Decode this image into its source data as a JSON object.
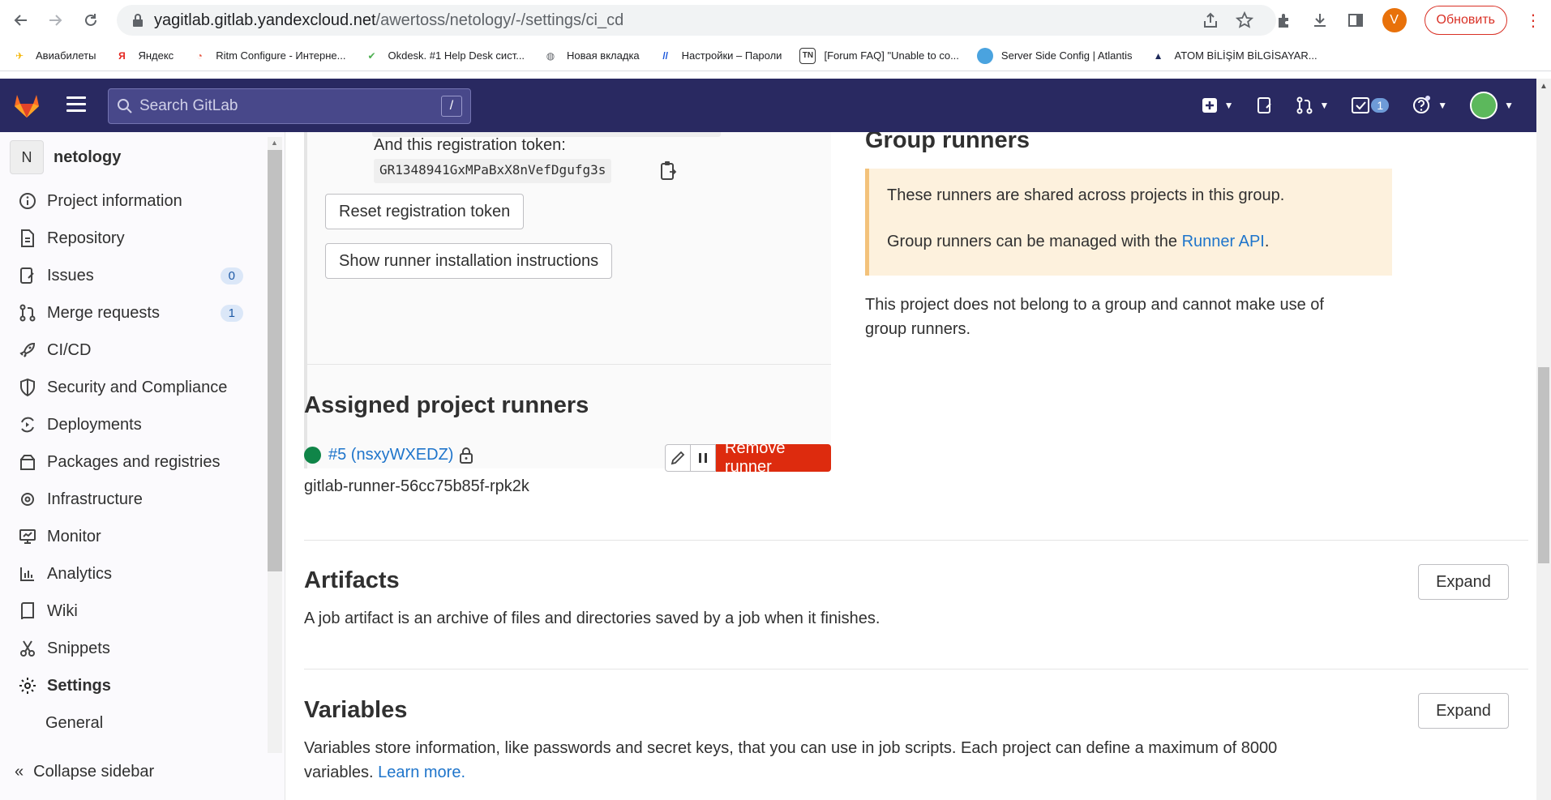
{
  "browser": {
    "url_host": "yagitlab.gitlab.yandexcloud.net",
    "url_path": "/awertoss/netology/-/settings/ci_cd",
    "profile_initial": "V",
    "update_label": "Обновить"
  },
  "bookmarks": [
    {
      "label": "Авиабилеты",
      "icon": "plane-icon",
      "color": "#f4b400"
    },
    {
      "label": "Яндекс",
      "icon": "yandex-icon",
      "color": "#e52620"
    },
    {
      "label": "Ritm Configure - Интерне...",
      "icon": "ritm-icon",
      "color": "#e5533d"
    },
    {
      "label": "Okdesk. #1 Help Desk сист...",
      "icon": "okdesk-icon",
      "color": "#4caf50"
    },
    {
      "label": "Новая вкладка",
      "icon": "globe-icon",
      "color": "#5f6368"
    },
    {
      "label": "Настройки – Пароли",
      "icon": "settings-pw-icon",
      "color": "#1a56db"
    },
    {
      "label": "[Forum FAQ] \"Unable to co...",
      "icon": "tn-icon",
      "color": "#333333"
    },
    {
      "label": "Server Side Config | Atlantis",
      "icon": "atlantis-icon",
      "color": "#4aa3df"
    },
    {
      "label": "ATOM BİLİŞİM BİLGİSAYAR...",
      "icon": "atom-icon",
      "color": "#1e2a5a"
    }
  ],
  "gitlab_header": {
    "search_placeholder": "Search GitLab",
    "search_shortcut": "/",
    "todo_count": "1"
  },
  "sidebar": {
    "project_initial": "N",
    "project_name": "netology",
    "items": [
      {
        "label": "Project information",
        "icon": "info-icon"
      },
      {
        "label": "Repository",
        "icon": "document-icon"
      },
      {
        "label": "Issues",
        "icon": "issues-icon",
        "count": "0"
      },
      {
        "label": "Merge requests",
        "icon": "merge-request-icon",
        "count": "1"
      },
      {
        "label": "CI/CD",
        "icon": "rocket-icon"
      },
      {
        "label": "Security and Compliance",
        "icon": "shield-icon"
      },
      {
        "label": "Deployments",
        "icon": "deployments-icon"
      },
      {
        "label": "Packages and registries",
        "icon": "package-icon"
      },
      {
        "label": "Infrastructure",
        "icon": "cloud-gear-icon"
      },
      {
        "label": "Monitor",
        "icon": "monitor-icon"
      },
      {
        "label": "Analytics",
        "icon": "chart-icon"
      },
      {
        "label": "Wiki",
        "icon": "book-icon"
      },
      {
        "label": "Snippets",
        "icon": "snippet-icon"
      },
      {
        "label": "Settings",
        "icon": "gear-icon"
      }
    ],
    "sub_item": "General",
    "collapse_label": "Collapse sidebar"
  },
  "runners": {
    "token_label": "And this registration token:",
    "token_value": "GR1348941GxMPaBxX8nVefDgufg3s",
    "reset_button": "Reset registration token",
    "show_instructions_button": "Show runner installation instructions",
    "assigned_title": "Assigned project runners",
    "runner_link": "#5 (nsxyWXEDZ)",
    "runner_description": "gitlab-runner-56cc75b85f-rpk2k",
    "runner_status_color": "#108548",
    "remove_button": "Remove runner",
    "group_title": "Group runners",
    "group_info_1": "These runners are shared across projects in this group.",
    "group_info_2_prefix": "Group runners can be managed with the ",
    "group_info_2_link": "Runner API",
    "group_info_2_suffix": ".",
    "group_note": "This project does not belong to a group and cannot make use of group runners."
  },
  "artifacts": {
    "title": "Artifacts",
    "description": "A job artifact is an archive of files and directories saved by a job when it finishes.",
    "expand_label": "Expand"
  },
  "variables": {
    "title": "Variables",
    "description": "Variables store information, like passwords and secret keys, that you can use in job scripts. Each project can define a maximum of 8000 variables.",
    "learn_more": "Learn more.",
    "expand_label": "Expand"
  }
}
